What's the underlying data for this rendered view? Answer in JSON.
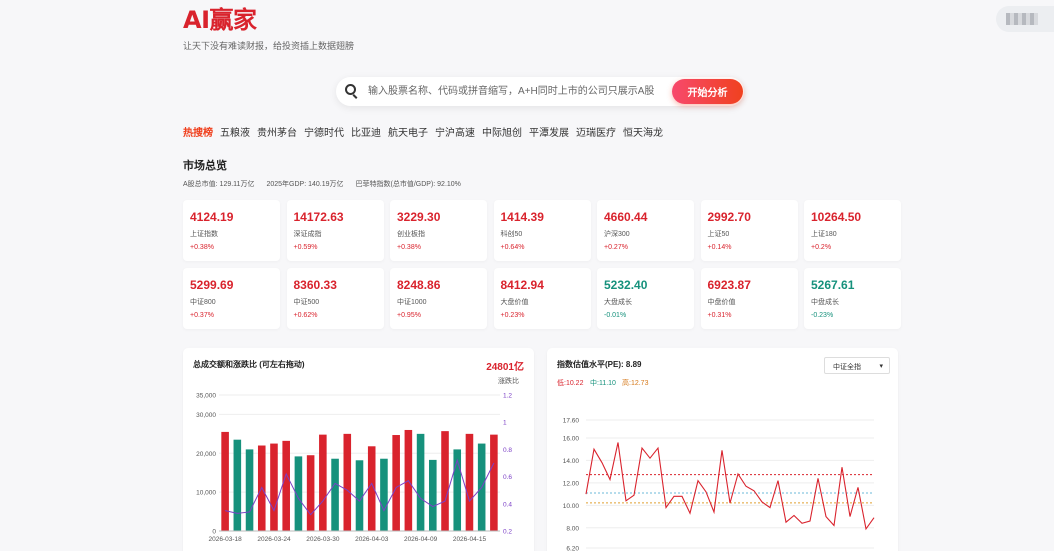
{
  "header": {
    "logo": "AI赢家",
    "slogan": "让天下没有难读财报，给投资插上数据翅膀"
  },
  "search": {
    "placeholder": "输入股票名称、代码或拼音缩写，A+H同时上市的公司只展示A股",
    "button": "开始分析",
    "icon": "search-icon"
  },
  "hot": {
    "label": "热搜榜",
    "items": [
      "五粮液",
      "贵州茅台",
      "宁德时代",
      "比亚迪",
      "航天电子",
      "宁沪高速",
      "中际旭创",
      "平潭发展",
      "迈瑞医疗",
      "恒天海龙"
    ]
  },
  "market": {
    "title": "市场总览",
    "stats": [
      "A股总市值: 129.11万亿",
      "2025年GDP: 140.19万亿",
      "巴菲特指数(总市值/GDP): 92.10%"
    ],
    "indices": [
      {
        "value": "4124.19",
        "name": "上证指数",
        "change": "+0.38%",
        "dir": "up"
      },
      {
        "value": "14172.63",
        "name": "深证成指",
        "change": "+0.59%",
        "dir": "up"
      },
      {
        "value": "3229.30",
        "name": "创业板指",
        "change": "+0.38%",
        "dir": "up"
      },
      {
        "value": "1414.39",
        "name": "科创50",
        "change": "+0.64%",
        "dir": "up"
      },
      {
        "value": "4660.44",
        "name": "沪深300",
        "change": "+0.27%",
        "dir": "up"
      },
      {
        "value": "2992.70",
        "name": "上证50",
        "change": "+0.14%",
        "dir": "up"
      },
      {
        "value": "10264.50",
        "name": "上证180",
        "change": "+0.2%",
        "dir": "up"
      },
      {
        "value": "5299.69",
        "name": "中证800",
        "change": "+0.37%",
        "dir": "up"
      },
      {
        "value": "8360.33",
        "name": "中证500",
        "change": "+0.62%",
        "dir": "up"
      },
      {
        "value": "8248.86",
        "name": "中证1000",
        "change": "+0.95%",
        "dir": "up"
      },
      {
        "value": "8412.94",
        "name": "大盘价值",
        "change": "+0.23%",
        "dir": "up"
      },
      {
        "value": "5232.40",
        "name": "大盘成长",
        "change": "-0.01%",
        "dir": "down"
      },
      {
        "value": "6923.87",
        "name": "中盘价值",
        "change": "+0.31%",
        "dir": "up"
      },
      {
        "value": "5267.61",
        "name": "中盘成长",
        "change": "-0.23%",
        "dir": "down"
      }
    ]
  },
  "volume_chart": {
    "title": "总成交额和涨跌比 (可左右拖动)",
    "total": "24801亿",
    "right_label": "涨跌比"
  },
  "pe_chart": {
    "title": "指数估值水平(PE):",
    "pe_value": "8.89",
    "low": "低:10.22",
    "mid": "中:11.10",
    "high": "高:12.73",
    "select": "中证全指"
  },
  "colors": {
    "up": "#d9232d",
    "down": "#16917c",
    "ratio_line": "#7b3fc6",
    "pe_line": "#d9232d",
    "low_line": "#e0a030",
    "mid_line": "#6bb8d8",
    "high_line": "#d9232d"
  },
  "chart_data": [
    {
      "type": "bar",
      "title": "总成交额和涨跌比 (可左右拖动)",
      "x_tick_labels": [
        "2026-03-18",
        "2026-03-24",
        "2026-03-30",
        "2026-04-03",
        "2026-04-09",
        "2026-04-15"
      ],
      "series": [
        {
          "values": [
            25500,
            23500,
            21000,
            22000,
            22500,
            23200,
            19200,
            19500,
            24800,
            18600,
            25000,
            18200,
            21800,
            18600,
            24700,
            26000,
            25000,
            18300,
            25700,
            21000,
            25000,
            22500,
            24800
          ],
          "up_down": [
            "up",
            "down",
            "down",
            "up",
            "up",
            "up",
            "down",
            "up",
            "up",
            "down",
            "up",
            "down",
            "up",
            "down",
            "up",
            "up",
            "down",
            "down",
            "up",
            "down",
            "up",
            "down",
            "up"
          ]
        },
        {
          "name": "涨跌比",
          "values": [
            0.35,
            0.33,
            0.34,
            0.52,
            0.35,
            0.62,
            0.44,
            0.32,
            0.42,
            0.55,
            0.5,
            0.42,
            0.55,
            0.35,
            0.52,
            0.57,
            0.44,
            0.38,
            0.42,
            0.72,
            0.42,
            0.52,
            0.7
          ]
        }
      ],
      "ylim": [
        0,
        35000
      ],
      "y_ticks": [
        "0",
        "10,000",
        "20,000",
        "30,000",
        "35,000"
      ],
      "y2lim": [
        0.2,
        1.2
      ],
      "y2_ticks": [
        "0.2",
        "0.4",
        "0.6",
        "0.8",
        "1",
        "1.2"
      ]
    },
    {
      "type": "line",
      "title": "指数估值水平(PE): 8.89",
      "y_ticks": [
        "6.20",
        "8.00",
        "10.00",
        "12.00",
        "14.00",
        "16.00",
        "17.60"
      ],
      "ylim": [
        6.2,
        17.6
      ],
      "series": [
        {
          "values": [
            11.0,
            15.0,
            13.8,
            12.3,
            15.6,
            10.4,
            10.9,
            15.1,
            14.2,
            15.1,
            9.8,
            10.8,
            10.8,
            9.3,
            12.2,
            11.2,
            9.4,
            14.9,
            10.2,
            12.8,
            11.7,
            11.3,
            10.3,
            9.8,
            12.2,
            8.5,
            9.1,
            8.4,
            8.6,
            12.4,
            9.0,
            8.2,
            13.4,
            9.0,
            11.6,
            7.9,
            8.9
          ]
        }
      ],
      "reference_lines": [
        {
          "label": "低",
          "value": 10.22
        },
        {
          "label": "中",
          "value": 11.1
        },
        {
          "label": "高",
          "value": 12.73
        }
      ]
    }
  ]
}
